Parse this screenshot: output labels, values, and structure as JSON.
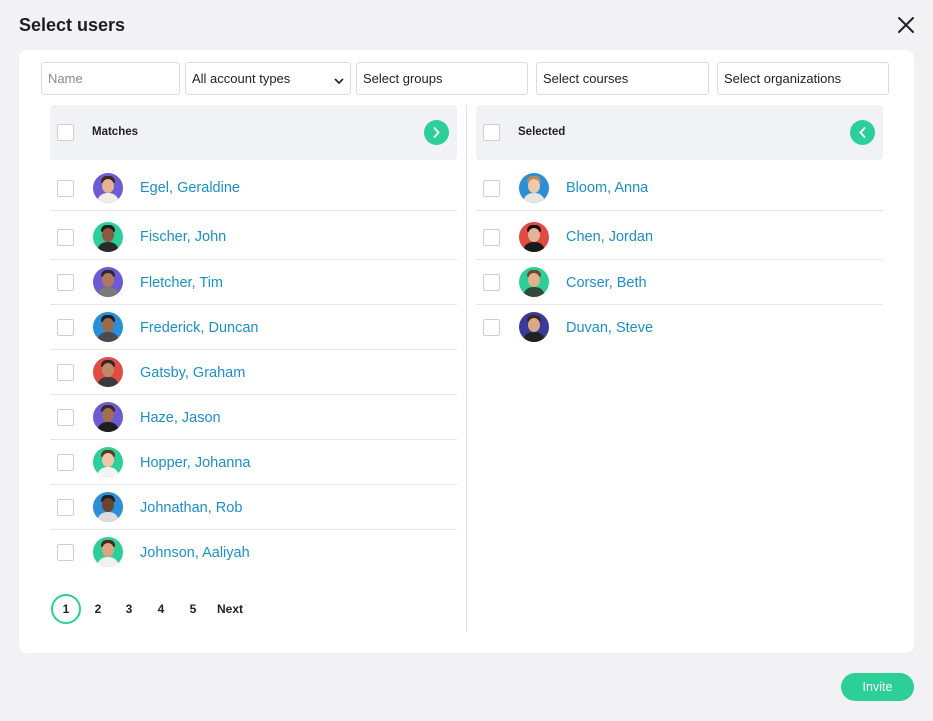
{
  "dialog": {
    "title": "Select users",
    "close_icon": "close-icon"
  },
  "filters": {
    "name_placeholder": "Name",
    "account_type": "All account types",
    "groups": "Select groups",
    "courses": "Select courses",
    "organizations": "Select organizations"
  },
  "matches": {
    "header": "Matches",
    "move_icon": "chevron-right-icon",
    "users": [
      {
        "name": "Egel, Geraldine"
      },
      {
        "name": "Fischer, John"
      },
      {
        "name": "Fletcher, Tim"
      },
      {
        "name": "Frederick, Duncan"
      },
      {
        "name": "Gatsby, Graham"
      },
      {
        "name": "Haze, Jason"
      },
      {
        "name": "Hopper, Johanna"
      },
      {
        "name": "Johnathan, Rob"
      },
      {
        "name": "Johnson, Aaliyah"
      }
    ]
  },
  "selected": {
    "header": "Selected",
    "move_icon": "chevron-left-icon",
    "users": [
      {
        "name": "Bloom, Anna"
      },
      {
        "name": "Chen, Jordan"
      },
      {
        "name": "Corser, Beth"
      },
      {
        "name": "Duvan, Steve"
      }
    ]
  },
  "pagination": {
    "pages": [
      "1",
      "2",
      "3",
      "4",
      "5"
    ],
    "current": "1",
    "next": "Next"
  },
  "actions": {
    "invite": "Invite"
  },
  "colors": {
    "accent": "#2dcf98",
    "link": "#1c8fc7"
  }
}
